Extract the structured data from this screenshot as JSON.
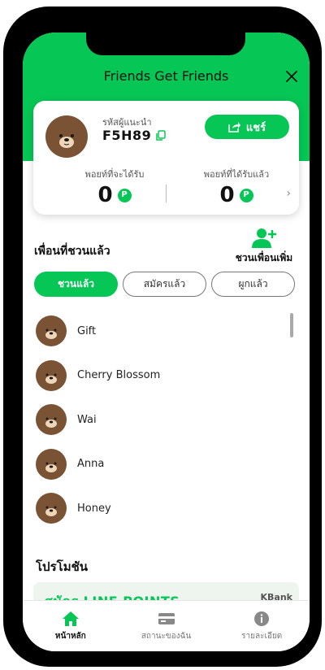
{
  "header": {
    "title": "Friends Get Friends",
    "close_icon": "close-icon"
  },
  "referral": {
    "code_label": "รหัสผู้แนะนำ",
    "code": "F5H89",
    "share_label": "แชร์",
    "points_pending_label": "พอยท์ที่จะได้รับ",
    "points_pending": "0",
    "points_received_label": "พอยท์ที่ได้รับแล้ว",
    "points_received": "0",
    "point_badge": "P"
  },
  "friends": {
    "section_title": "เพื่อนที่ชวนแล้ว",
    "invite_more_label": "ชวนเพื่อนเพิ่ม",
    "tabs": [
      {
        "label": "ชวนแล้ว",
        "active": true
      },
      {
        "label": "สมัครแล้ว",
        "active": false
      },
      {
        "label": "ผูกแล้ว",
        "active": false
      }
    ],
    "list": [
      {
        "name": "Gift"
      },
      {
        "name": "Cherry Blossom"
      },
      {
        "name": "Wai"
      },
      {
        "name": "Anna"
      },
      {
        "name": "Honey"
      }
    ]
  },
  "promotions": {
    "title": "โปรโมชัน",
    "banner_text": "สมัคร LINE POINTS",
    "banner_brand": "KBank"
  },
  "bottom_nav": {
    "items": [
      {
        "label": "หน้าหลัก",
        "icon": "home-icon",
        "active": true
      },
      {
        "label": "สถานะของฉัน",
        "icon": "card-icon",
        "active": false
      },
      {
        "label": "รายละเอียด",
        "icon": "info-icon",
        "active": false
      }
    ]
  },
  "colors": {
    "brand_green": "#06c755",
    "avatar_brown": "#7a5234"
  }
}
